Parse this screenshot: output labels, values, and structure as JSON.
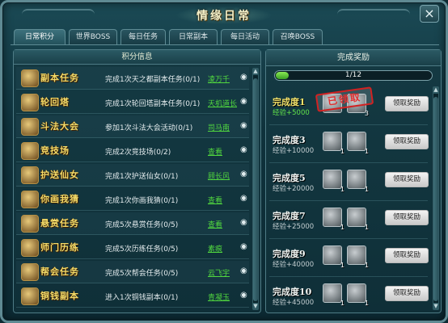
{
  "window": {
    "title": "情缘日常",
    "close_label": "×"
  },
  "tabs": [
    "日常积分",
    "世界BOSS",
    "每日任务",
    "日常副本",
    "每日活动",
    "召唤BOSS"
  ],
  "active_tab": 0,
  "left_panel": {
    "header": "积分信息",
    "tasks": [
      {
        "name": "副本任务",
        "desc": "完成1次天之都副本任务(0/1)",
        "link": "凌万千"
      },
      {
        "name": "轮回塔",
        "desc": "完成1次轮回塔副本任务(0/1)",
        "link": "天机道长"
      },
      {
        "name": "斗法大会",
        "desc": "参加1次斗法大会活动(0/1)",
        "link": "司马南"
      },
      {
        "name": "竞技场",
        "desc": "完成2次竞技场(0/2)",
        "link": "查看"
      },
      {
        "name": "护送仙女",
        "desc": "完成1次护送仙女(0/1)",
        "link": "顾长风"
      },
      {
        "name": "你画我猜",
        "desc": "完成1次你画我猜(0/1)",
        "link": "查看"
      },
      {
        "name": "悬赏任务",
        "desc": "完成5次悬赏任务(0/5)",
        "link": "查看"
      },
      {
        "name": "师门历练",
        "desc": "完成5次历练任务(0/5)",
        "link": "素痕"
      },
      {
        "name": "帮会任务",
        "desc": "完成5次帮会任务(0/5)",
        "link": "云飞宇"
      },
      {
        "name": "铜钱副本",
        "desc": "进入1次铜钱副本(0/1)",
        "link": "青凝玉"
      }
    ]
  },
  "right_panel": {
    "header": "完成奖励",
    "progress_text": "1/12",
    "progress_fraction": 0.083,
    "rewards": [
      {
        "title": "完成度1",
        "exp": "经验+5000",
        "item1_count": "",
        "item2_count": "3",
        "claimed": true,
        "stamp": "已领取",
        "button": "领取奖励"
      },
      {
        "title": "完成度3",
        "exp": "经验+10000",
        "item1_count": "1",
        "item2_count": "1",
        "claimed": false,
        "button": "领取奖励"
      },
      {
        "title": "完成度5",
        "exp": "经验+20000",
        "item1_count": "1",
        "item2_count": "1",
        "claimed": false,
        "button": "领取奖励"
      },
      {
        "title": "完成度7",
        "exp": "经验+25000",
        "item1_count": "1",
        "item2_count": "1",
        "claimed": false,
        "button": "领取奖励"
      },
      {
        "title": "完成度9",
        "exp": "经验+40000",
        "item1_count": "1",
        "item2_count": "1",
        "claimed": false,
        "button": "领取奖励"
      },
      {
        "title": "完成度10",
        "exp": "经验+45000",
        "item1_count": "1",
        "item2_count": "1",
        "claimed": false,
        "button": "领取奖励"
      }
    ]
  },
  "colors": {
    "link": "#51d83f",
    "task_name": "#f2dc6a",
    "stamp": "#d12222",
    "progress": "#6ccf3d"
  }
}
